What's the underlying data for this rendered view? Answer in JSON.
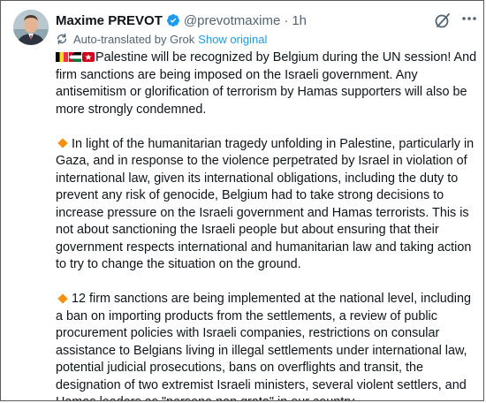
{
  "post": {
    "author_name": "Maxime PREVOT",
    "handle": "@prevotmaxime",
    "separator": "·",
    "timestamp": "1h",
    "translation_label": "Auto-translated by Grok",
    "show_original": "Show original",
    "paragraph1": "Palestine will be recognized by Belgium during the UN session! And firm sanctions are being imposed on the Israeli government. Any antisemitism or glorification of terrorism by Hamas supporters will also be more strongly condemned.",
    "paragraph2": "In light of the humanitarian tragedy unfolding in Palestine, particularly in Gaza, and in response to the violence perpetrated by Israel in violation of international law, given its international obligations, including the duty to prevent any risk of genocide, Belgium had to take strong decisions to increase pressure on the Israeli government and Hamas terrorists. This is not about sanctioning the Israeli people but about ensuring that their government respects international and humanitarian law and taking action to try to change the situation on the ground.",
    "paragraph3": "12 firm sanctions are being implemented at the national level, including a ban on importing products from the settlements, a review of public procurement policies with Israeli companies, restrictions on consular assistance to Belgians living in illegal settlements under international law, potential judicial prosecutions, bans on overflights and transit, the designation of two extremist Israeli ministers, several violent settlers, and Hamas leaders as \"persona non grata\" in our country..."
  },
  "icons": {
    "flags": [
      "belgium-flag-icon",
      "palestine-flag-icon",
      "red-star-flag-icon"
    ],
    "bullet": "orange-diamond-icon",
    "verified": "verified-badge-icon",
    "grok": "grok-icon",
    "more": "more-icon",
    "translate": "translate-icon"
  },
  "colors": {
    "link": "#1d9bf0",
    "secondary_text": "#536471",
    "primary_text": "#0f1419",
    "verified_badge": "#1d9bf0",
    "bullet": "#f4900c"
  }
}
